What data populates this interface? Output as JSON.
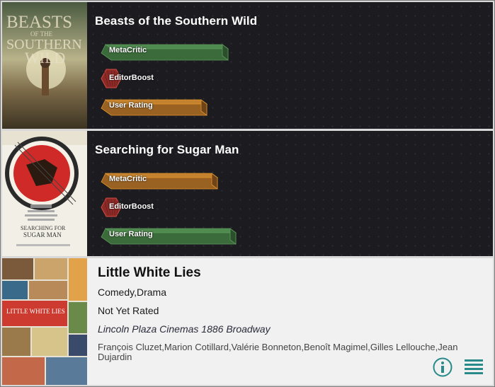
{
  "colors": {
    "dark_card": "#1c1b20",
    "light_card": "#f1f1f1",
    "green_bar": "#3c6d3c",
    "orange_bar": "#b56f20",
    "red_hex": "#a0332e",
    "icon_teal": "#2a8a8a"
  },
  "movies": [
    {
      "title": "Beasts of the Southern Wild",
      "poster_icon": "movie-poster-image",
      "ratings": [
        {
          "label": "MetaCritic",
          "color": "green",
          "level": 0.9
        },
        {
          "label": "EditorBoost",
          "color": "red",
          "level": 0.0
        },
        {
          "label": "User Rating",
          "color": "orange",
          "level": 0.74
        }
      ]
    },
    {
      "title": "Searching for Sugar Man",
      "poster_icon": "movie-poster-image",
      "ratings": [
        {
          "label": "MetaCritic",
          "color": "orange",
          "level": 0.82
        },
        {
          "label": "EditorBoost",
          "color": "red",
          "level": 0.0
        },
        {
          "label": "User Rating",
          "color": "green",
          "level": 0.96
        }
      ]
    },
    {
      "title": "Little White Lies",
      "poster_icon": "movie-poster-image",
      "genre": "Comedy,Drama",
      "rating": "Not Yet Rated",
      "theater": "Lincoln Plaza Cinemas 1886 Broadway",
      "cast": "François Cluzet,Marion Cotillard,Valérie Bonneton,Benoît Magimel,Gilles Lellouche,Jean Dujardin",
      "actions": [
        "info-icon",
        "menu-list-icon"
      ]
    }
  ]
}
